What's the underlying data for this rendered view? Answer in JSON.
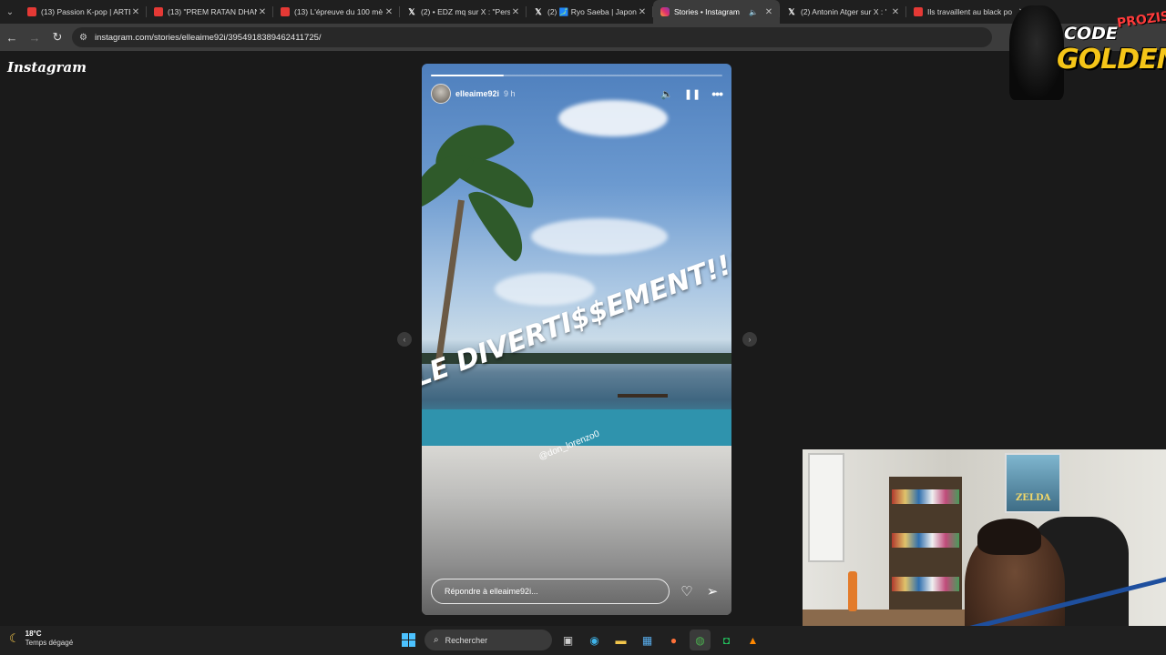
{
  "browser": {
    "tabs": [
      {
        "title": "(13) Passion K-pop | ARTE",
        "icon": "youtube-icon",
        "active": false
      },
      {
        "title": "(13) \"PREM RATAN DHAN",
        "icon": "youtube-icon",
        "active": false
      },
      {
        "title": "(13) L'épreuve du 100 mè",
        "icon": "youtube-icon",
        "active": false
      },
      {
        "title": "(2) • EDZ mq sur X : \"Pers",
        "icon": "x-icon",
        "active": false
      },
      {
        "title": "(2) 🗾 Ryo Saeba | Japon",
        "icon": "x-icon",
        "active": false
      },
      {
        "title": "Stories • Instagram",
        "icon": "instagram-icon",
        "active": true
      },
      {
        "title": "(2) Antonin Atger sur X : '",
        "icon": "x-icon",
        "active": false
      },
      {
        "title": "Ils travaillent au black po",
        "icon": "youtube-icon",
        "active": false
      }
    ],
    "url": "instagram.com/stories/elleaime92i/3954918389462411725/"
  },
  "page": {
    "logo": "Instagram"
  },
  "story": {
    "username": "elleaime92i",
    "time": "9 h",
    "progress": 0.25,
    "sticker_text": "LE DIVERTI$$EMENT!!!",
    "mention": "@don_lorenzo0",
    "reply_placeholder": "Répondre à elleaime92i..."
  },
  "overlay": {
    "logo_code": "CODE",
    "logo_prozis": "PROZIS",
    "logo_golden": "GOLDENG",
    "poster_text": "ZELDA"
  },
  "taskbar": {
    "temperature": "18°C",
    "condition": "Temps dégagé",
    "search_label": "Rechercher"
  },
  "colors": {
    "chrome_bg": "#1f1f1f",
    "page_bg": "#1a1a1a",
    "taskbar_bg": "#202020",
    "logo_gold": "#f5c518"
  }
}
